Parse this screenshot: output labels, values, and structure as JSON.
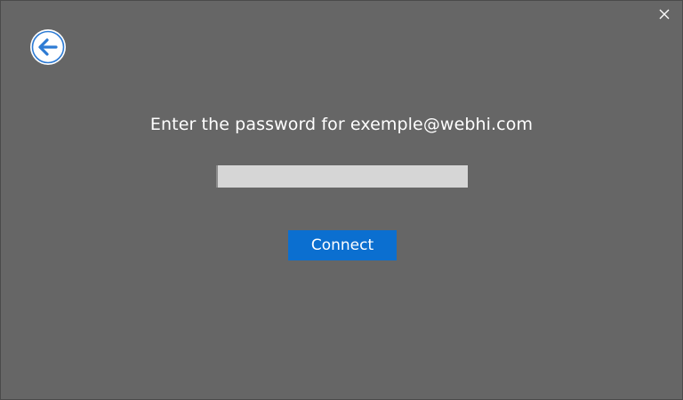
{
  "dialog": {
    "close_icon": "close-icon",
    "back_icon": "arrow-left-icon",
    "prompt": "Enter the password for exemple@webhi.com",
    "password": {
      "value": "",
      "placeholder": ""
    },
    "connect_label": "Connect"
  },
  "colors": {
    "background": "#666666",
    "input_background": "#d6d6d6",
    "button_background": "#0b6fd0",
    "back_arrow": "#2d7bd4",
    "text": "#ffffff"
  }
}
